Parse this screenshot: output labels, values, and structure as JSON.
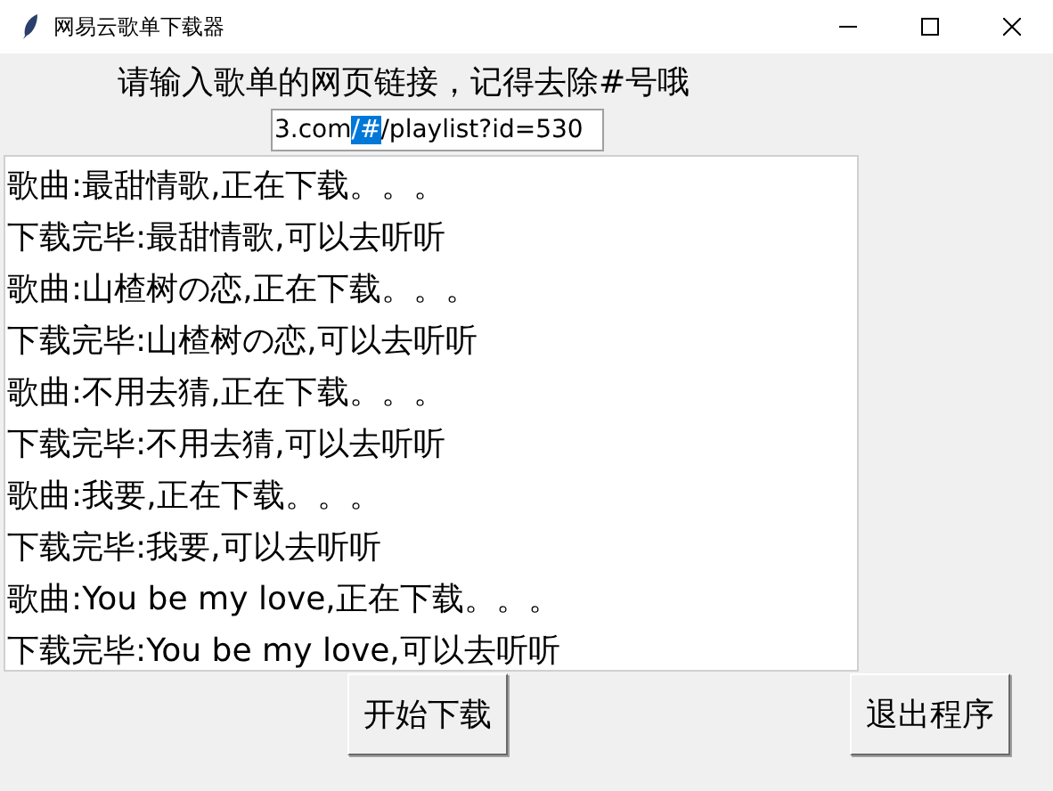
{
  "window": {
    "title": "网易云歌单下载器"
  },
  "prompt": "请输入歌单的网页链接，记得去除#号哦",
  "url_field": {
    "value_before_selection": "3.com",
    "selected_text": "/#",
    "value_after_selection": "/playlist?id=530"
  },
  "log_lines": [
    "歌曲:最甜情歌,正在下载。。。",
    "下载完毕:最甜情歌,可以去听听",
    "歌曲:山楂树の恋,正在下载。。。",
    "下载完毕:山楂树の恋,可以去听听",
    "歌曲:不用去猜,正在下载。。。",
    "下载完毕:不用去猜,可以去听听",
    "歌曲:我要,正在下载。。。",
    "下载完毕:我要,可以去听听",
    "歌曲:You be my love,正在下载。。。",
    "下载完毕:You be my love,可以去听听"
  ],
  "buttons": [
    "开始下载",
    "退出程序"
  ]
}
